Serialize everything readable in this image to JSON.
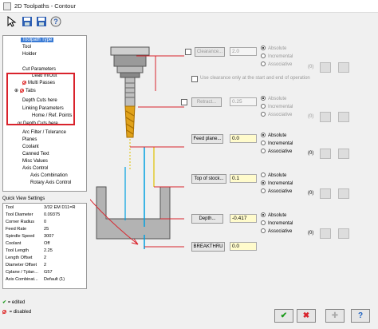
{
  "window": {
    "title": "2D Toolpaths - Contour"
  },
  "tree": {
    "items": [
      {
        "label": "Toolpath Type"
      },
      {
        "label": "Tool"
      },
      {
        "label": "Holder"
      },
      {
        "label": "Cut Parameters"
      },
      {
        "label": "Lead In/Out"
      },
      {
        "label": "Multi Passes"
      },
      {
        "label": "Tabs"
      },
      {
        "label": "Depth Cuts here"
      },
      {
        "label": "Linking Parameters"
      },
      {
        "label": "Home / Ref. Points"
      },
      {
        "label": "or Depth Cuts here"
      },
      {
        "label": "Arc Filter / Tolerance"
      },
      {
        "label": "Planes"
      },
      {
        "label": "Coolant"
      },
      {
        "label": "Canned Text"
      },
      {
        "label": "Misc Values"
      },
      {
        "label": "Axis Control"
      },
      {
        "label": "Axis Combination"
      },
      {
        "label": "Rotary Axis Control"
      }
    ]
  },
  "quick_view": {
    "title": "Quick View Settings",
    "rows": [
      {
        "k": "Tool",
        "v": "3/32 EM D11=R"
      },
      {
        "k": "Tool Diameter",
        "v": "0.09375"
      },
      {
        "k": "Corner Radius",
        "v": "0"
      },
      {
        "k": "Feed Rate",
        "v": "25"
      },
      {
        "k": "Spindle Speed",
        "v": "3007"
      },
      {
        "k": "Coolant",
        "v": "Off"
      },
      {
        "k": "Tool Length",
        "v": "2.25"
      },
      {
        "k": "Length Offset",
        "v": "2"
      },
      {
        "k": "Diameter Offset",
        "v": "2"
      },
      {
        "k": "Cplane / Tplan...",
        "v": "G57"
      },
      {
        "k": "Axis Combinat...",
        "v": "Default (1)"
      }
    ]
  },
  "legend": {
    "edited": "= edited",
    "disabled": "= disabled"
  },
  "params": {
    "clearance": {
      "label": "Clearance...",
      "value": "2.0",
      "badge": "(0)"
    },
    "use_clearance": "Use clearance only at the start and end of operation",
    "retract": {
      "label": "Retract...",
      "value": "0.25",
      "badge": "(0)"
    },
    "feed_plane": {
      "label": "Feed plane...",
      "value": "0.0",
      "badge": "(0)"
    },
    "top_of_stock": {
      "label": "Top of stock...",
      "value": "0.1",
      "badge": "(0)"
    },
    "depth": {
      "label": "Depth...",
      "value": "-0.417",
      "badge": "(0)"
    },
    "breakthru": {
      "label": "BREAKTHRU",
      "value": "0.0"
    },
    "modes": {
      "absolute": "Absolute",
      "incremental": "Incremental",
      "associative": "Associative"
    }
  },
  "colors": {
    "accent": "#3a7bd5",
    "red": "#d9232c",
    "field_yellow": "#fffbcc"
  }
}
